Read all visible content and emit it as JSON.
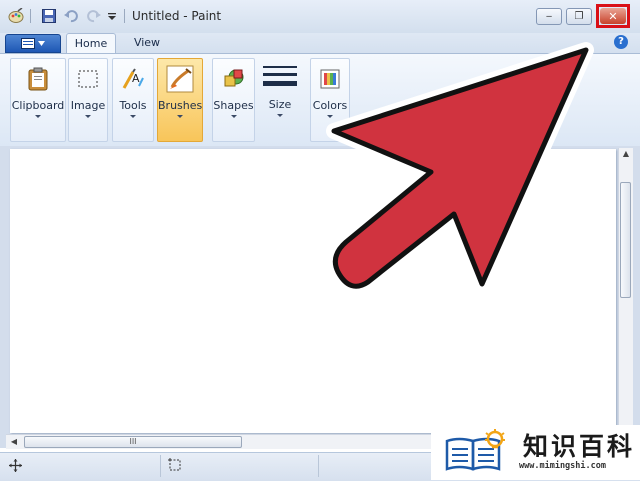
{
  "window": {
    "title": "Untitled - Paint"
  },
  "window_buttons": {
    "minimize": "‒",
    "restore": "❐",
    "close": "✕"
  },
  "tabs": [
    {
      "label": "Home",
      "active": true
    },
    {
      "label": "View",
      "active": false
    }
  ],
  "help": "?",
  "ribbon_groups": [
    {
      "label": "Clipboard",
      "icon": "clipboard-icon"
    },
    {
      "label": "Image",
      "icon": "select-rectangle-icon"
    },
    {
      "label": "Tools",
      "icon": "tools-icon"
    },
    {
      "label": "Brushes",
      "icon": "brush-icon",
      "selected": true
    },
    {
      "label": "Shapes",
      "icon": "shapes-icon"
    },
    {
      "label": "Size",
      "icon": "line-size-icon"
    },
    {
      "label": "Colors",
      "icon": "palette-icon"
    }
  ],
  "hscroll_grip": "III",
  "colors": {
    "arrow_fill": "#d0333f",
    "close_highlight": "#d90f17",
    "brush_selected": "#f8c55a"
  },
  "watermark": {
    "title": "知识百科",
    "url": "www.mimingshi.com"
  }
}
